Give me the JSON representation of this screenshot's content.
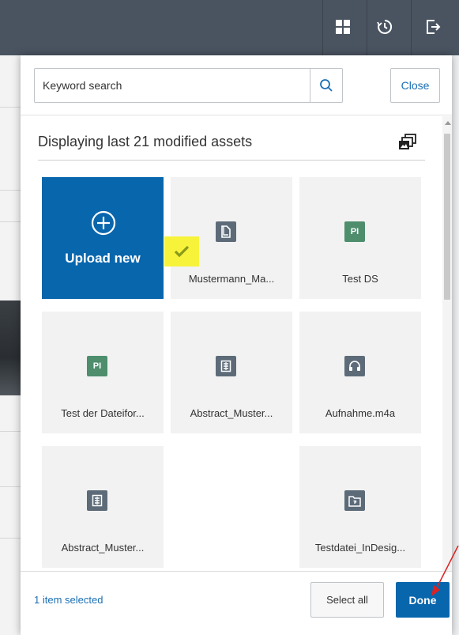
{
  "topbar": {
    "icons": [
      "grid-icon",
      "history-icon",
      "logout-icon"
    ]
  },
  "search": {
    "placeholder": "Keyword search",
    "value": ""
  },
  "close_label": "Close",
  "heading": "Displaying last 21 modified assets",
  "upload_label": "Upload new",
  "assets": [
    {
      "name": "Mustermann_Ma...",
      "icon": "document-icon",
      "selected": true
    },
    {
      "name": "Test DS",
      "icon": "pi-file-icon",
      "badge": "PI"
    },
    {
      "name": "Test der Dateifor...",
      "icon": "pi-file-icon",
      "badge": "PI"
    },
    {
      "name": "Abstract_Muster...",
      "icon": "archive-icon"
    },
    {
      "name": "Aufnahme.m4a",
      "icon": "audio-icon"
    },
    {
      "name": "Abstract_Muster...",
      "icon": "archive-icon"
    },
    {
      "name": "Testdatei_InDesig...",
      "icon": "indesign-folder-icon"
    }
  ],
  "footer": {
    "selected_text": "1 item selected",
    "select_all": "Select all",
    "done": "Done"
  },
  "colors": {
    "topbar": "#4a5461",
    "accent": "#0866ad",
    "link": "#1a6fb5",
    "highlight": "#f7f33a",
    "check": "#8a9a1a",
    "pi_badge": "#4e8e6d",
    "file_icon": "#5d6b79",
    "annotation_arrow": "#e02020"
  }
}
